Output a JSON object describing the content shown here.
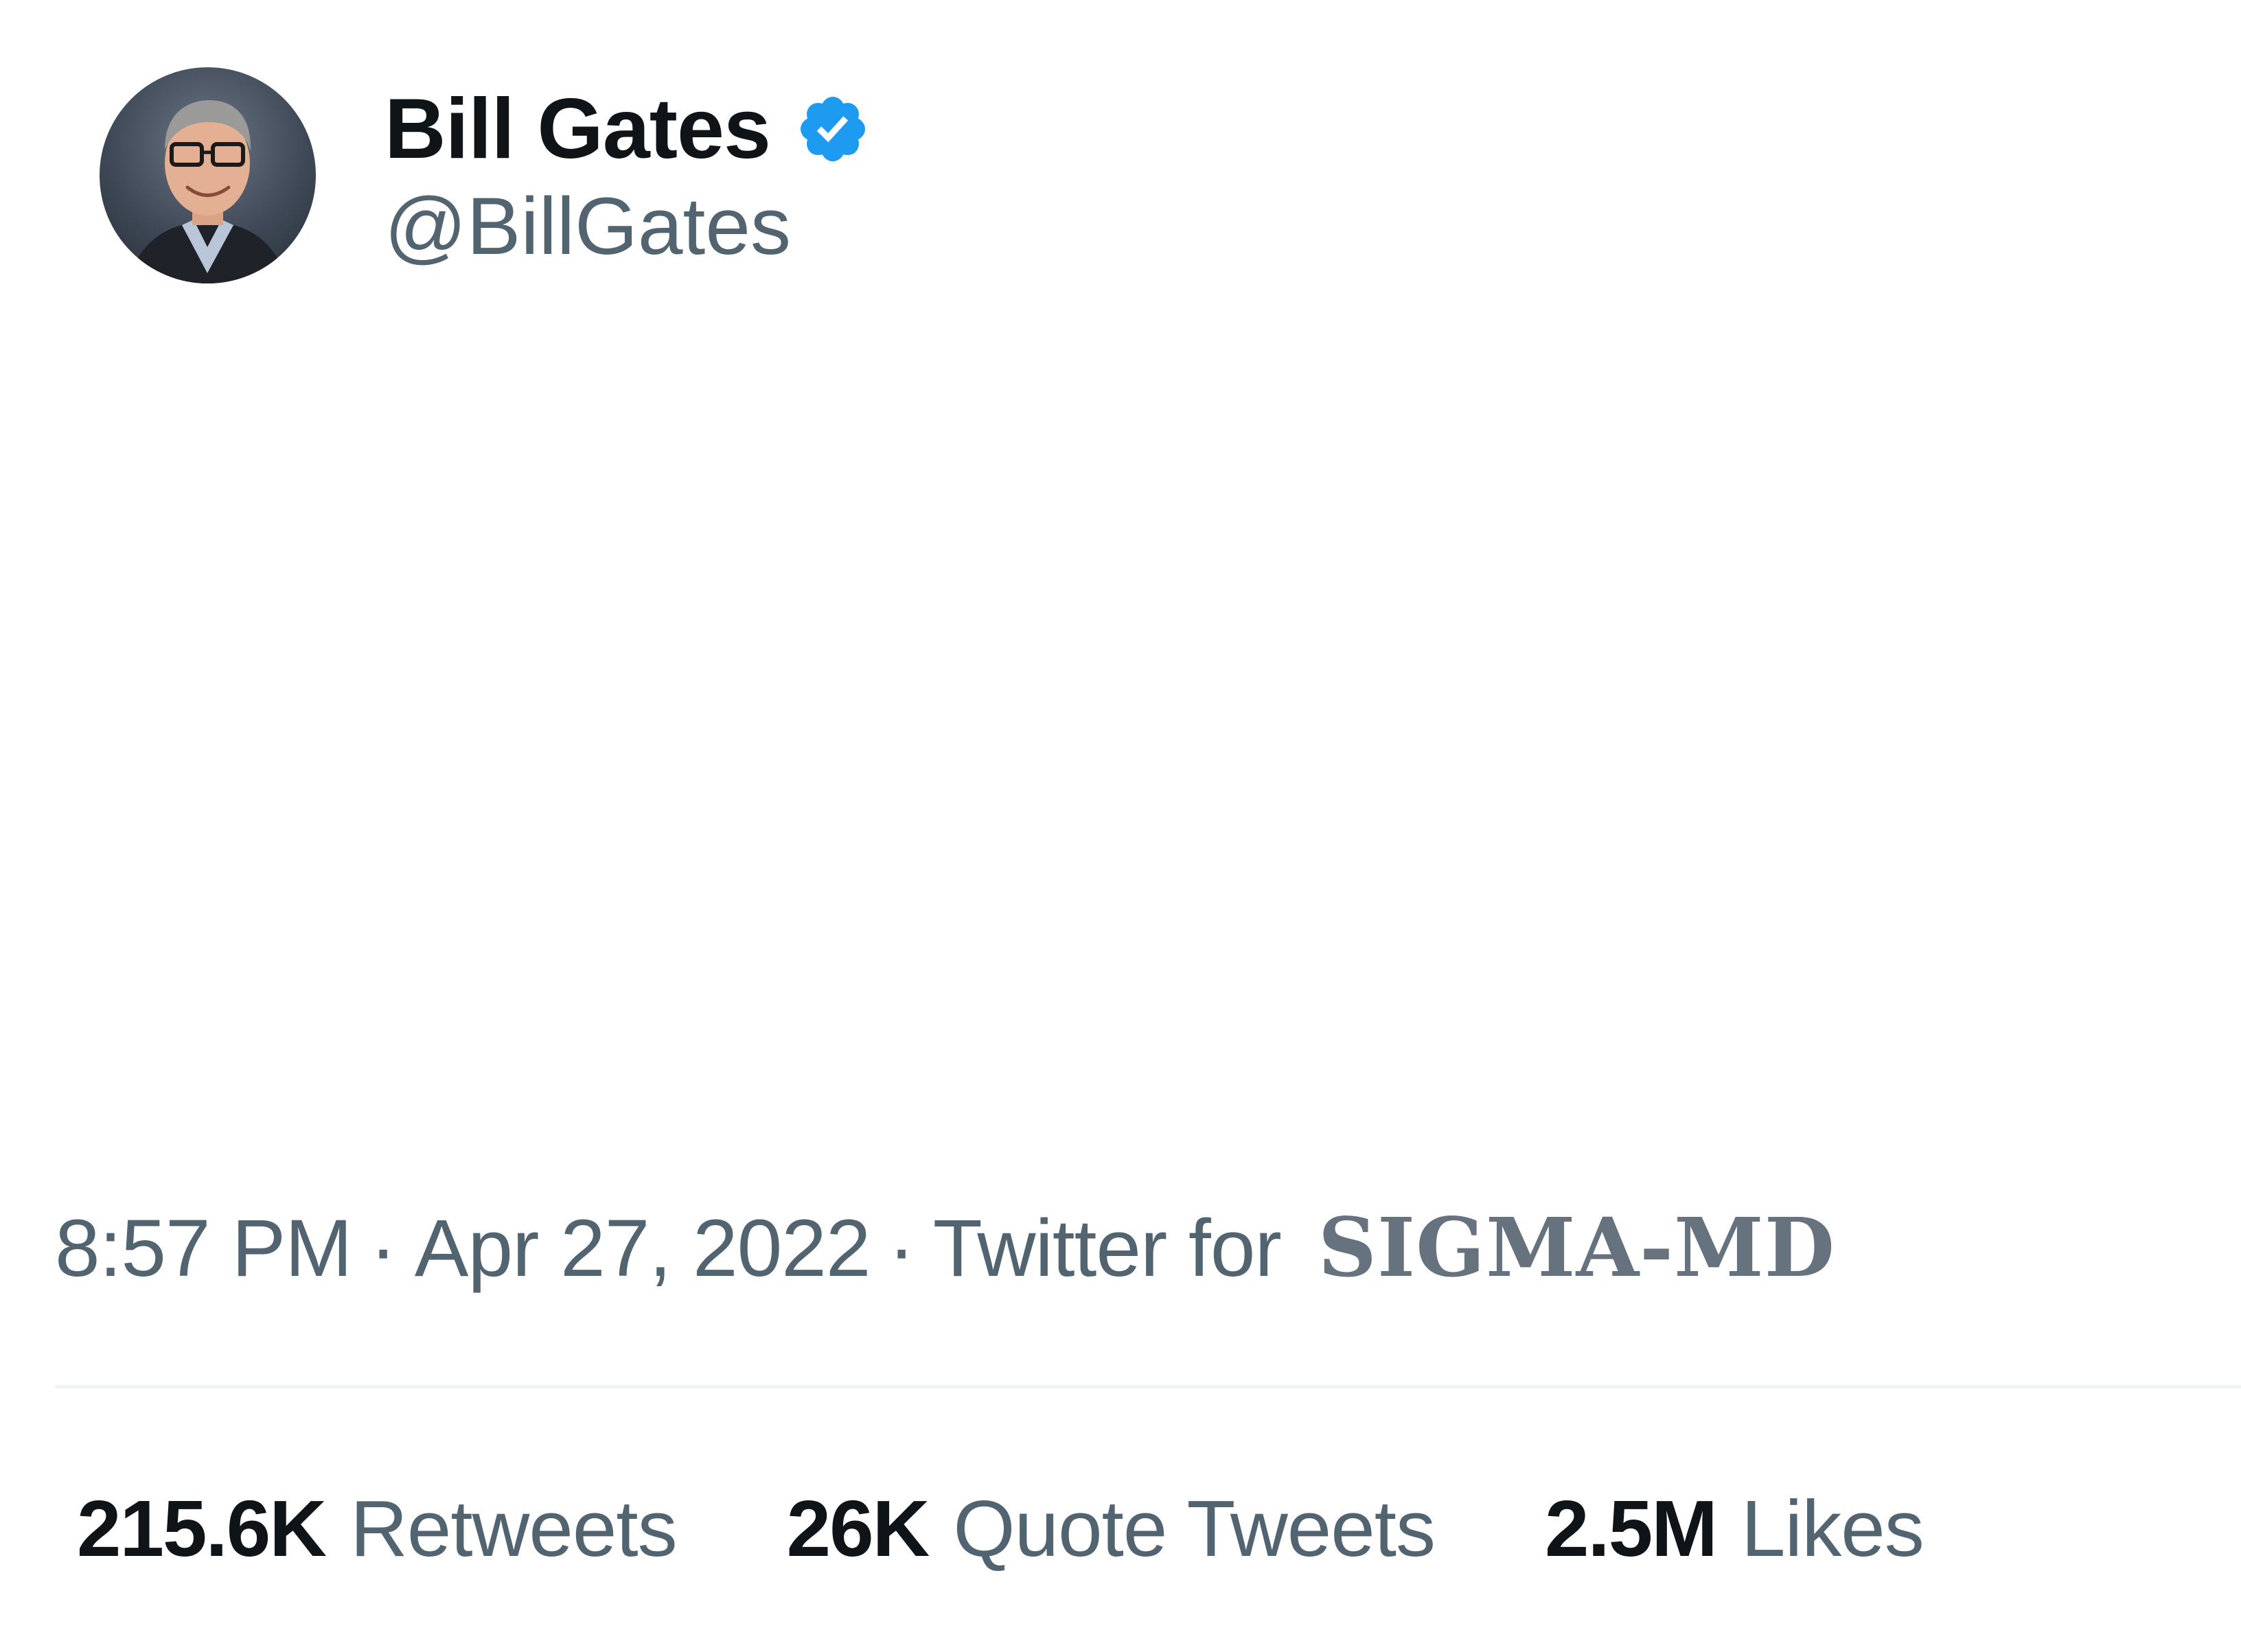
{
  "author": {
    "display_name": "Bill Gates",
    "handle": "@BillGates",
    "verified_icon": "verified-badge-icon",
    "accent_color": "#1d9bf0"
  },
  "meta": {
    "time": "8:57 PM",
    "separator": "·",
    "date": "Apr 27, 2022",
    "client_prefix": "Twitter for",
    "client_name": "SIGMA-MD"
  },
  "stats": [
    {
      "value": "215.6K",
      "label": "Retweets"
    },
    {
      "value": "26K",
      "label": "Quote Tweets"
    },
    {
      "value": "2.5M",
      "label": "Likes"
    }
  ]
}
